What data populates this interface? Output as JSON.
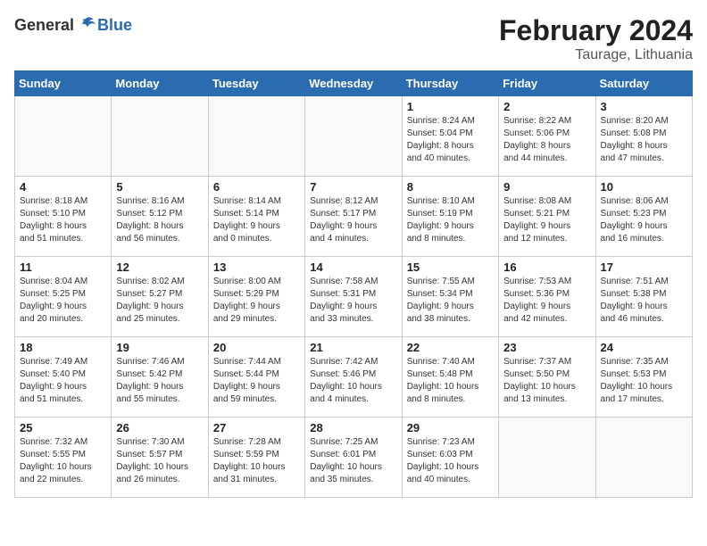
{
  "header": {
    "logo_general": "General",
    "logo_blue": "Blue",
    "title": "February 2024",
    "location": "Taurage, Lithuania"
  },
  "weekdays": [
    "Sunday",
    "Monday",
    "Tuesday",
    "Wednesday",
    "Thursday",
    "Friday",
    "Saturday"
  ],
  "weeks": [
    [
      {
        "day": "",
        "info": ""
      },
      {
        "day": "",
        "info": ""
      },
      {
        "day": "",
        "info": ""
      },
      {
        "day": "",
        "info": ""
      },
      {
        "day": "1",
        "info": "Sunrise: 8:24 AM\nSunset: 5:04 PM\nDaylight: 8 hours\nand 40 minutes."
      },
      {
        "day": "2",
        "info": "Sunrise: 8:22 AM\nSunset: 5:06 PM\nDaylight: 8 hours\nand 44 minutes."
      },
      {
        "day": "3",
        "info": "Sunrise: 8:20 AM\nSunset: 5:08 PM\nDaylight: 8 hours\nand 47 minutes."
      }
    ],
    [
      {
        "day": "4",
        "info": "Sunrise: 8:18 AM\nSunset: 5:10 PM\nDaylight: 8 hours\nand 51 minutes."
      },
      {
        "day": "5",
        "info": "Sunrise: 8:16 AM\nSunset: 5:12 PM\nDaylight: 8 hours\nand 56 minutes."
      },
      {
        "day": "6",
        "info": "Sunrise: 8:14 AM\nSunset: 5:14 PM\nDaylight: 9 hours\nand 0 minutes."
      },
      {
        "day": "7",
        "info": "Sunrise: 8:12 AM\nSunset: 5:17 PM\nDaylight: 9 hours\nand 4 minutes."
      },
      {
        "day": "8",
        "info": "Sunrise: 8:10 AM\nSunset: 5:19 PM\nDaylight: 9 hours\nand 8 minutes."
      },
      {
        "day": "9",
        "info": "Sunrise: 8:08 AM\nSunset: 5:21 PM\nDaylight: 9 hours\nand 12 minutes."
      },
      {
        "day": "10",
        "info": "Sunrise: 8:06 AM\nSunset: 5:23 PM\nDaylight: 9 hours\nand 16 minutes."
      }
    ],
    [
      {
        "day": "11",
        "info": "Sunrise: 8:04 AM\nSunset: 5:25 PM\nDaylight: 9 hours\nand 20 minutes."
      },
      {
        "day": "12",
        "info": "Sunrise: 8:02 AM\nSunset: 5:27 PM\nDaylight: 9 hours\nand 25 minutes."
      },
      {
        "day": "13",
        "info": "Sunrise: 8:00 AM\nSunset: 5:29 PM\nDaylight: 9 hours\nand 29 minutes."
      },
      {
        "day": "14",
        "info": "Sunrise: 7:58 AM\nSunset: 5:31 PM\nDaylight: 9 hours\nand 33 minutes."
      },
      {
        "day": "15",
        "info": "Sunrise: 7:55 AM\nSunset: 5:34 PM\nDaylight: 9 hours\nand 38 minutes."
      },
      {
        "day": "16",
        "info": "Sunrise: 7:53 AM\nSunset: 5:36 PM\nDaylight: 9 hours\nand 42 minutes."
      },
      {
        "day": "17",
        "info": "Sunrise: 7:51 AM\nSunset: 5:38 PM\nDaylight: 9 hours\nand 46 minutes."
      }
    ],
    [
      {
        "day": "18",
        "info": "Sunrise: 7:49 AM\nSunset: 5:40 PM\nDaylight: 9 hours\nand 51 minutes."
      },
      {
        "day": "19",
        "info": "Sunrise: 7:46 AM\nSunset: 5:42 PM\nDaylight: 9 hours\nand 55 minutes."
      },
      {
        "day": "20",
        "info": "Sunrise: 7:44 AM\nSunset: 5:44 PM\nDaylight: 9 hours\nand 59 minutes."
      },
      {
        "day": "21",
        "info": "Sunrise: 7:42 AM\nSunset: 5:46 PM\nDaylight: 10 hours\nand 4 minutes."
      },
      {
        "day": "22",
        "info": "Sunrise: 7:40 AM\nSunset: 5:48 PM\nDaylight: 10 hours\nand 8 minutes."
      },
      {
        "day": "23",
        "info": "Sunrise: 7:37 AM\nSunset: 5:50 PM\nDaylight: 10 hours\nand 13 minutes."
      },
      {
        "day": "24",
        "info": "Sunrise: 7:35 AM\nSunset: 5:53 PM\nDaylight: 10 hours\nand 17 minutes."
      }
    ],
    [
      {
        "day": "25",
        "info": "Sunrise: 7:32 AM\nSunset: 5:55 PM\nDaylight: 10 hours\nand 22 minutes."
      },
      {
        "day": "26",
        "info": "Sunrise: 7:30 AM\nSunset: 5:57 PM\nDaylight: 10 hours\nand 26 minutes."
      },
      {
        "day": "27",
        "info": "Sunrise: 7:28 AM\nSunset: 5:59 PM\nDaylight: 10 hours\nand 31 minutes."
      },
      {
        "day": "28",
        "info": "Sunrise: 7:25 AM\nSunset: 6:01 PM\nDaylight: 10 hours\nand 35 minutes."
      },
      {
        "day": "29",
        "info": "Sunrise: 7:23 AM\nSunset: 6:03 PM\nDaylight: 10 hours\nand 40 minutes."
      },
      {
        "day": "",
        "info": ""
      },
      {
        "day": "",
        "info": ""
      }
    ]
  ]
}
